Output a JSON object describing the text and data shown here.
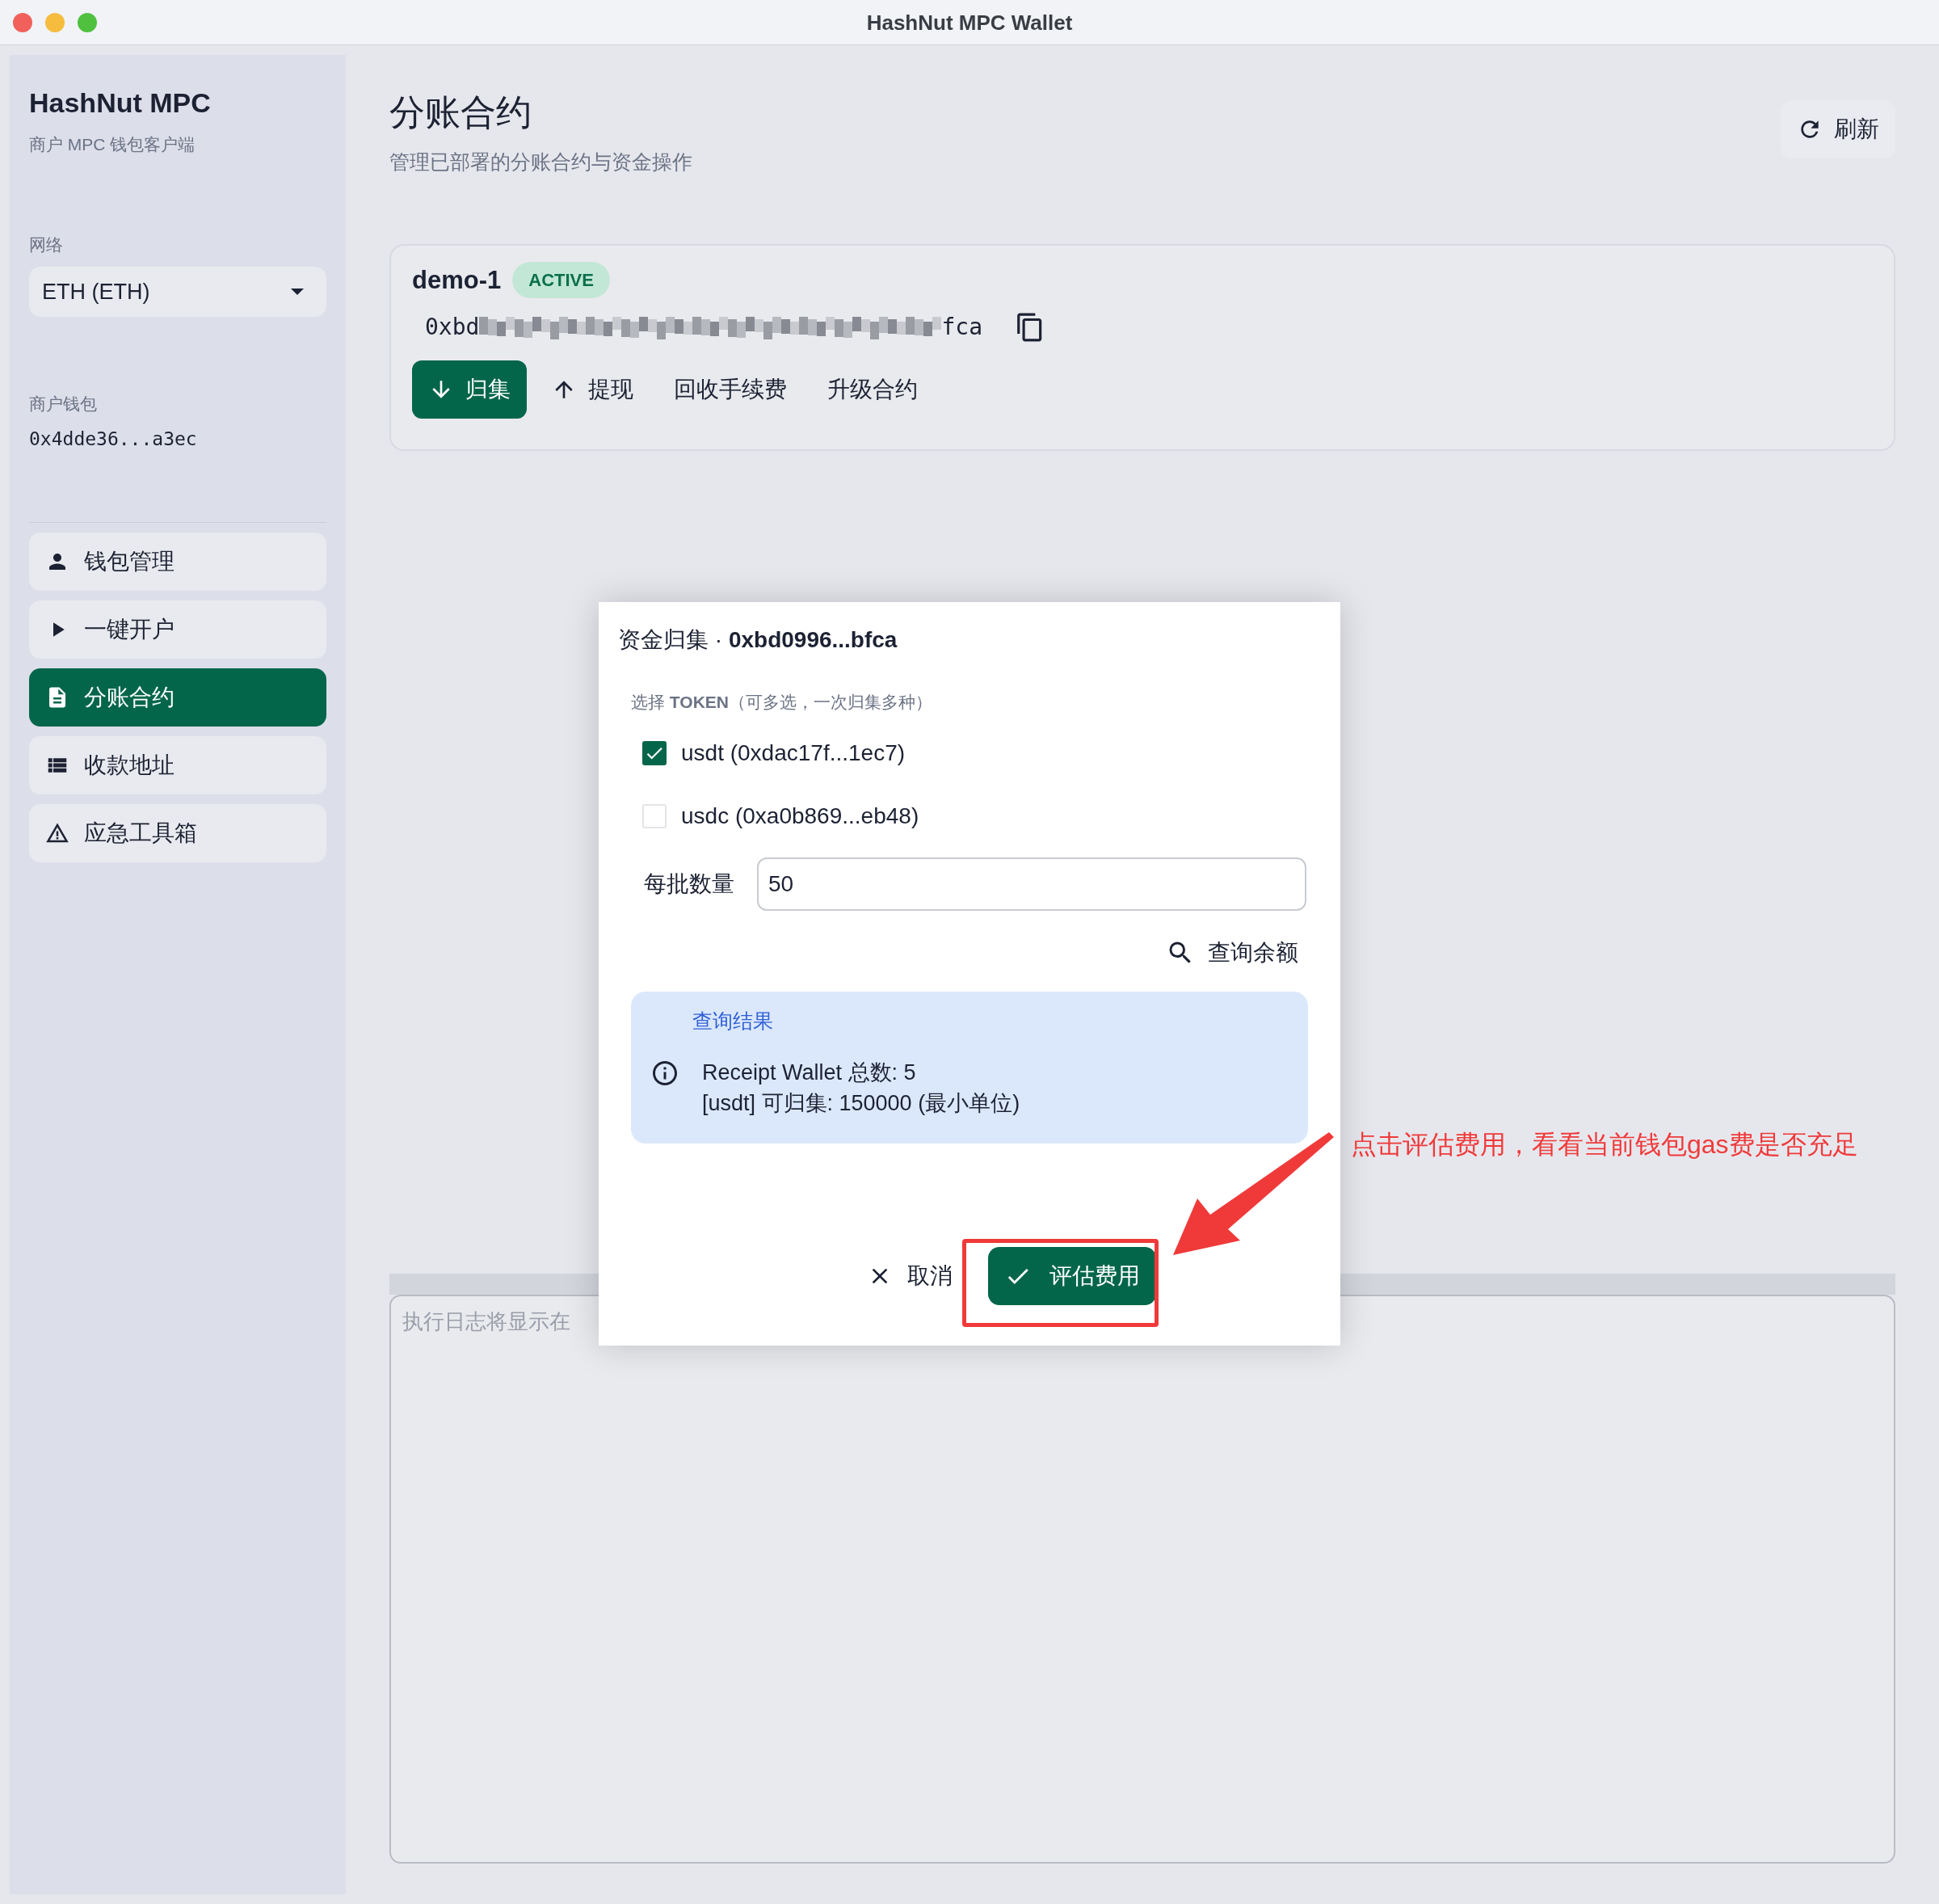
{
  "window": {
    "title": "HashNut MPC Wallet"
  },
  "sidebar": {
    "app_name": "HashNut MPC",
    "subtitle": "商户 MPC 钱包客户端",
    "network_label": "网络",
    "network": "ETH (ETH)",
    "wallet_label": "商户钱包",
    "wallet_address": "0x4dde36...a3ec",
    "nav": [
      {
        "label": "钱包管理",
        "selected": false
      },
      {
        "label": "一键开户",
        "selected": false
      },
      {
        "label": "分账合约",
        "selected": true
      },
      {
        "label": "收款地址",
        "selected": false
      },
      {
        "label": "应急工具箱",
        "selected": false
      }
    ]
  },
  "page": {
    "title": "分账合约",
    "subtitle": "管理已部署的分账合约与资金操作",
    "refresh": "刷新"
  },
  "contract": {
    "name": "demo-1",
    "status": "ACTIVE",
    "address_start": "0xbd",
    "address_end": "fca",
    "actions": [
      {
        "label": "归集",
        "selected": true
      },
      {
        "label": "提现",
        "selected": false
      },
      {
        "label": "回收手续费",
        "selected": false
      },
      {
        "label": "升级合约",
        "selected": false
      }
    ]
  },
  "log": {
    "placeholder": "执行日志将显示在"
  },
  "dialog": {
    "title": "资金归集 · **0xbd0996...bfca**",
    "section_label": "选择 **TOKEN**（可多选，一次归集多种）",
    "tokens": [
      {
        "label": "usdt (0xdac17f...1ec7)",
        "checked": true
      },
      {
        "label": "usdc (0xa0b869...eb48)",
        "checked": false
      }
    ],
    "batch_label": "每批数量",
    "batch_value": "50",
    "query": "查询余额",
    "result": {
      "title": "查询结果",
      "lines": [
        "Receipt Wallet 总数: 5",
        "[usdt] 可归集: 150000 (最小单位)"
      ]
    },
    "cancel": "取消",
    "confirm": "评估费用"
  },
  "annotation": {
    "text": "点击评估费用，看看当前钱包gas费是否充足"
  }
}
